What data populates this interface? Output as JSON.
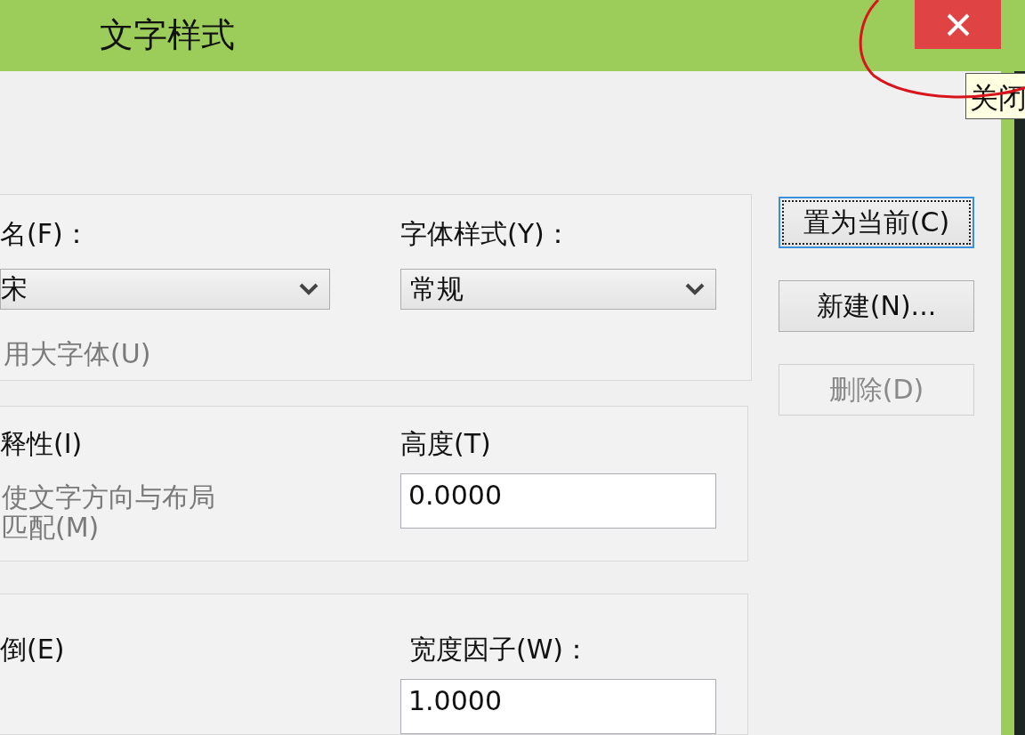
{
  "window": {
    "title": "文字样式",
    "close_tooltip": "关闭"
  },
  "font_group": {
    "font_name_label": "名(F)：",
    "font_name_value": "宋",
    "font_style_label": "字体样式(Y)：",
    "font_style_value": "常规",
    "big_font": {
      "label": "用大字体(U)",
      "disabled": true
    }
  },
  "size_group": {
    "annotative": {
      "label": "释性(I)",
      "disabled": false
    },
    "match_layout": {
      "label": "使文字方向与布局匹配(M)",
      "disabled": true
    },
    "height_label": "高度(T)",
    "height_value": "0.0000"
  },
  "effects_group": {
    "upside_down": {
      "label": "倒(E)",
      "disabled": false
    },
    "width_factor_label": "宽度因子(W)：",
    "width_factor_value": "1.0000"
  },
  "buttons": [
    {
      "label": "置为当前(C)",
      "focused": true,
      "disabled": false
    },
    {
      "label": "新建(N)...",
      "focused": false,
      "disabled": false
    },
    {
      "label": "删除(D)",
      "focused": false,
      "disabled": true
    }
  ]
}
